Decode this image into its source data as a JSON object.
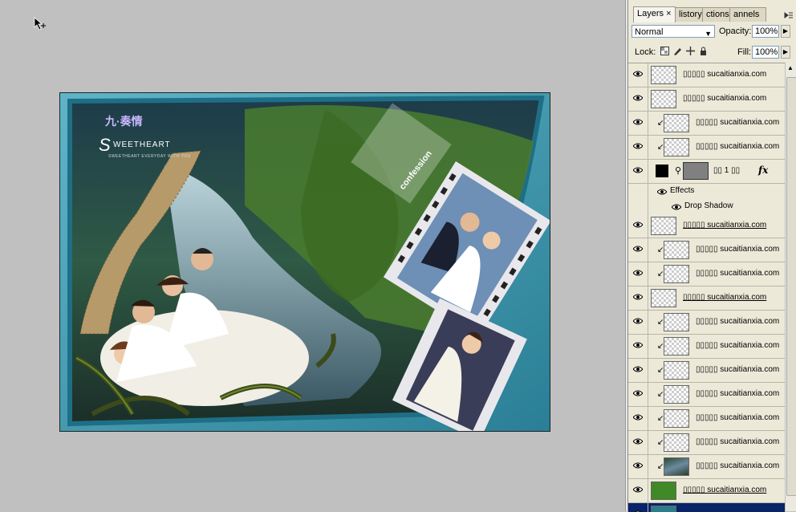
{
  "panel": {
    "tabs": [
      "Layers ×",
      "listory",
      "ctions",
      "annels"
    ],
    "blend_mode": "Normal",
    "opacity_label": "Opacity:",
    "opacity_value": "100%",
    "lock_label": "Lock:",
    "fill_label": "Fill:",
    "fill_value": "100%"
  },
  "layers": [
    {
      "name": "▯▯▯▯▯ sucaitianxia.com",
      "clip": false,
      "underline": false,
      "thumb": "checker"
    },
    {
      "name": "▯▯▯▯▯ sucaitianxia.com",
      "clip": false,
      "underline": false,
      "thumb": "checker"
    },
    {
      "name": "▯▯▯▯▯ sucaitianxia.com",
      "clip": true,
      "underline": false,
      "thumb": "checker"
    },
    {
      "name": "▯▯▯▯▯ sucaitianxia.com",
      "clip": true,
      "underline": false,
      "thumb": "checker"
    },
    {
      "name": "▯▯ 1 ▯▯",
      "clip": true,
      "underline": false,
      "thumb": "adjust",
      "fx": "fx"
    },
    {
      "name": "Effects",
      "kind": "effects"
    },
    {
      "name": "Drop Shadow",
      "kind": "effect-item"
    },
    {
      "name": "▯▯▯▯▯ sucaitianxia.com",
      "clip": false,
      "underline": true,
      "thumb": "checker"
    },
    {
      "name": "▯▯▯▯▯ sucaitianxia.com",
      "clip": true,
      "underline": false,
      "thumb": "checker"
    },
    {
      "name": "▯▯▯▯▯ sucaitianxia.com",
      "clip": true,
      "underline": false,
      "thumb": "checker"
    },
    {
      "name": "▯▯▯▯▯ sucaitianxia.com",
      "clip": false,
      "underline": true,
      "thumb": "checker"
    },
    {
      "name": "▯▯▯▯▯ sucaitianxia.com",
      "clip": true,
      "underline": false,
      "thumb": "checker"
    },
    {
      "name": "▯▯▯▯▯ sucaitianxia.com",
      "clip": true,
      "underline": false,
      "thumb": "checker"
    },
    {
      "name": "▯▯▯▯▯ sucaitianxia.com",
      "clip": true,
      "underline": false,
      "thumb": "checker"
    },
    {
      "name": "▯▯▯▯▯ sucaitianxia.com",
      "clip": true,
      "underline": false,
      "thumb": "checker"
    },
    {
      "name": "▯▯▯▯▯ sucaitianxia.com",
      "clip": true,
      "underline": false,
      "thumb": "checker"
    },
    {
      "name": "▯▯▯▯▯ sucaitianxia.com",
      "clip": true,
      "underline": false,
      "thumb": "checker"
    },
    {
      "name": "▯▯▯▯▯ sucaitianxia.com",
      "clip": true,
      "underline": false,
      "thumb": "photo"
    },
    {
      "name": "▯▯▯▯▯ sucaitianxia.com",
      "clip": false,
      "underline": true,
      "thumb": "green"
    },
    {
      "name": "",
      "clip": false,
      "underline": false,
      "thumb": "teal",
      "selected": true
    }
  ],
  "artwork": {
    "title_mark": "S",
    "title_text": "WEETHEART",
    "tagline": "SWEETHEART EVERYDAY WITH YOU",
    "cn_mark": "九·奏情",
    "film_text": "confession"
  },
  "colors": {
    "frame_teal": "#2d7d93",
    "selection": "#0a246a",
    "panel_bg": "#ece9d8",
    "canvas_bg": "#c0c0c0"
  }
}
